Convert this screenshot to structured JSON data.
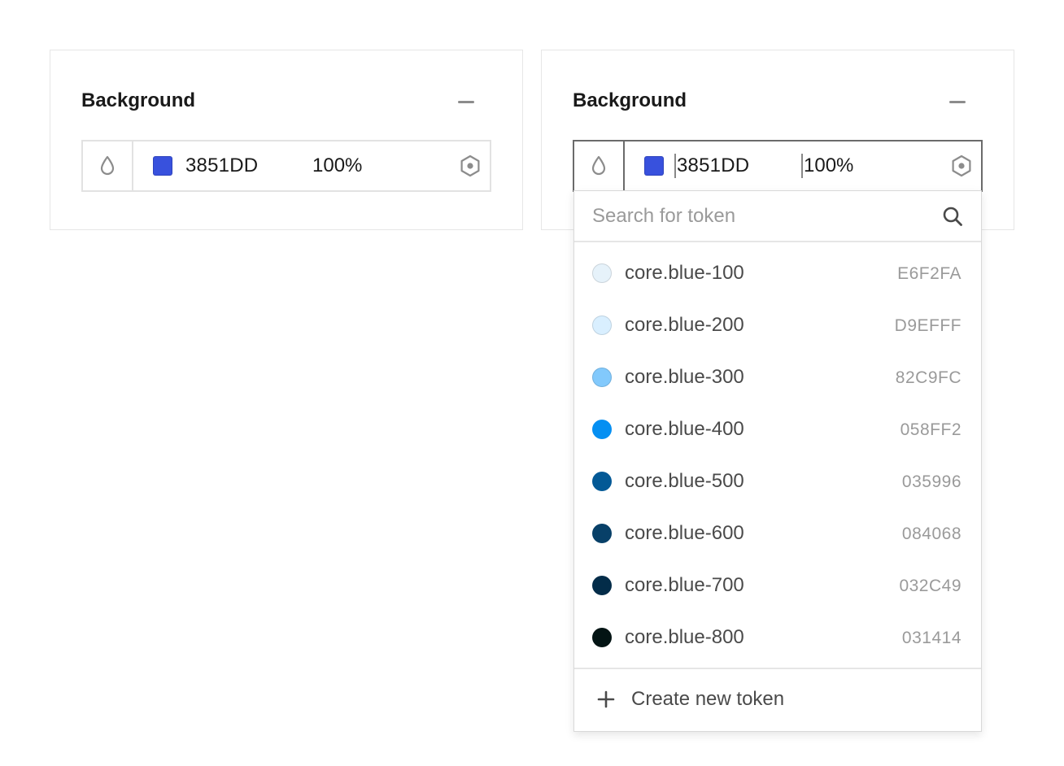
{
  "panels": [
    {
      "title": "Background",
      "hex": "3851DD",
      "opacity": "100%",
      "swatch_color": "#3851DD"
    },
    {
      "title": "Background",
      "hex": "3851DD",
      "opacity": "100%",
      "swatch_color": "#3851DD"
    }
  ],
  "icons": {
    "fill_type": "droplet-icon",
    "token": "hexagon-token-icon",
    "collapse": "minus-icon",
    "search": "search-icon",
    "add": "plus-icon"
  },
  "dropdown": {
    "search_placeholder": "Search for token",
    "tokens": [
      {
        "name": "core.blue-100",
        "hex": "E6F2FA",
        "color": "#E6F2FA"
      },
      {
        "name": "core.blue-200",
        "hex": "D9EFFF",
        "color": "#D9EFFF"
      },
      {
        "name": "core.blue-300",
        "hex": "82C9FC",
        "color": "#82C9FC"
      },
      {
        "name": "core.blue-400",
        "hex": "058FF2",
        "color": "#058FF2"
      },
      {
        "name": "core.blue-500",
        "hex": "035996",
        "color": "#035996"
      },
      {
        "name": "core.blue-600",
        "hex": "084068",
        "color": "#084068"
      },
      {
        "name": "core.blue-700",
        "hex": "032C49",
        "color": "#032C49"
      },
      {
        "name": "core.blue-800",
        "hex": "031414",
        "color": "#031414"
      }
    ],
    "create_label": "Create new token"
  }
}
